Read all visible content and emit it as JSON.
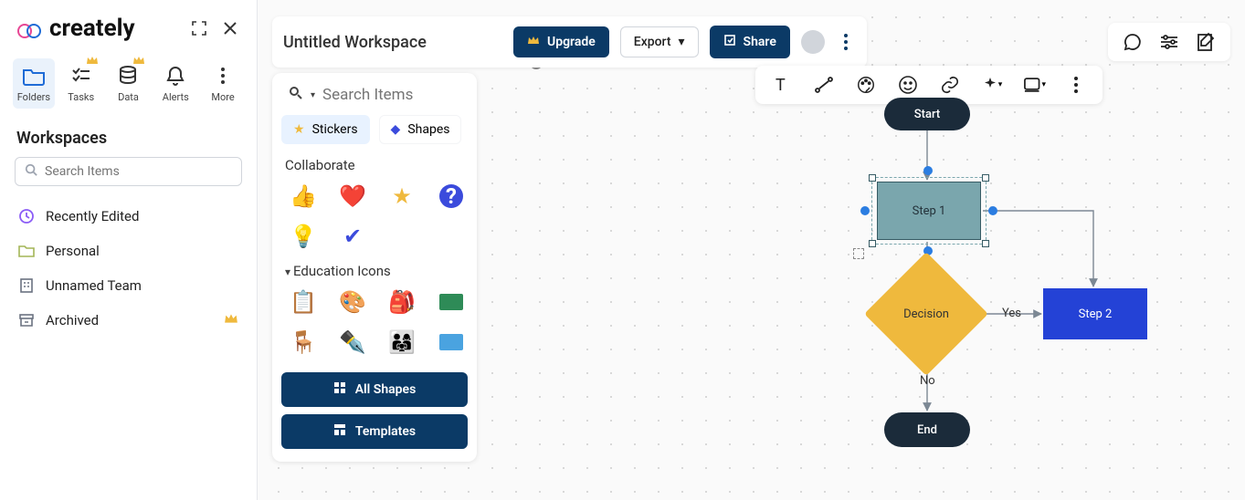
{
  "brand": {
    "name": "creately"
  },
  "sidebar": {
    "tiles": [
      {
        "label": "Folders"
      },
      {
        "label": "Tasks"
      },
      {
        "label": "Data"
      },
      {
        "label": "Alerts"
      },
      {
        "label": "More"
      }
    ],
    "heading": "Workspaces",
    "search_placeholder": "Search Items",
    "items": [
      {
        "label": "Recently Edited"
      },
      {
        "label": "Personal"
      },
      {
        "label": "Unnamed Team"
      },
      {
        "label": "Archived"
      }
    ]
  },
  "topbar": {
    "title": "Untitled Workspace",
    "upgrade_label": "Upgrade",
    "export_label": "Export",
    "share_label": "Share"
  },
  "panel": {
    "search_placeholder": "Search Items",
    "tabs": {
      "stickers": "Stickers",
      "shapes": "Shapes"
    },
    "sections": {
      "collaborate": "Collaborate",
      "education": "Education Icons"
    },
    "buttons": {
      "all_shapes": "All Shapes",
      "templates": "Templates"
    }
  },
  "flow": {
    "start": "Start",
    "step1": "Step 1",
    "decision": "Decision",
    "yes": "Yes",
    "no": "No",
    "step2": "Step 2",
    "end": "End"
  },
  "colors": {
    "brand_dark": "#0b3a66",
    "accent_blue": "#2442d6",
    "accent_teal": "#7aa6ad",
    "accent_yellow": "#efb93d",
    "shape_dark": "#1b2b3a"
  }
}
